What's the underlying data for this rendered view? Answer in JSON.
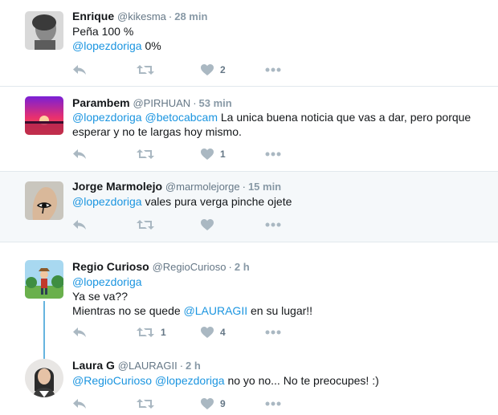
{
  "colors": {
    "accent": "#1b95e0",
    "muted": "#8899a6",
    "thread": "#66b4df"
  },
  "tweets": [
    {
      "name": "Enrique",
      "handle": "@kikesma",
      "time": "28 min",
      "line1_text": "Peña 100 %",
      "line2_mention": "@lopezdoriga",
      "line2_text": "0%",
      "like_count": "2",
      "retweet_count": ""
    },
    {
      "name": "Parambem",
      "handle": "@PIRHUAN",
      "time": "53 min",
      "mention1": "@lopezdoriga",
      "mention2": "@betocabcam",
      "text": "La unica buena noticia que vas a dar, pero porque esperar y no te largas hoy mismo.",
      "like_count": "1",
      "retweet_count": ""
    },
    {
      "name": "Jorge Marmolejo",
      "handle": "@marmolejorge",
      "time": "15 min",
      "mention1": "@lopezdoriga",
      "text": "vales pura verga pinche ojete",
      "like_count": "",
      "retweet_count": ""
    },
    {
      "name": "Regio Curioso",
      "handle": "@RegioCurioso",
      "time": "2 h",
      "mention1": "@lopezdoriga",
      "line2": "Ya se va??",
      "line3_before": "Mientras no se quede",
      "line3_mention": "@LAURAGII",
      "line3_after": "en su lugar!!",
      "like_count": "4",
      "retweet_count": "1"
    },
    {
      "name": "Laura G",
      "handle": "@LAURAGII",
      "time": "2 h",
      "mention1": "@RegioCurioso",
      "mention2": "@lopezdoriga",
      "text": "no yo no... No te preocupes! :)",
      "like_count": "9",
      "retweet_count": ""
    }
  ],
  "icons": [
    "reply-icon",
    "retweet-icon",
    "like-icon",
    "more-icon"
  ]
}
